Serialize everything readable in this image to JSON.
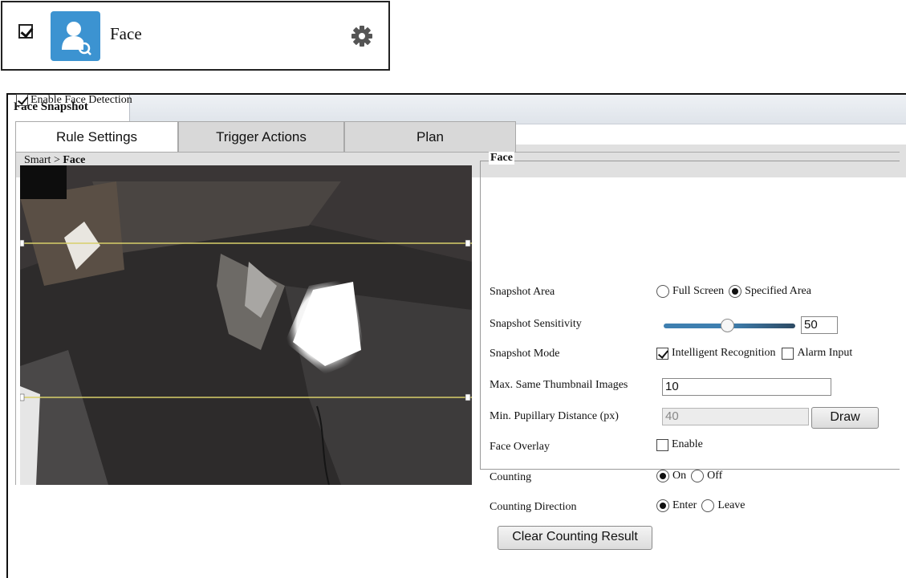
{
  "module": {
    "name": "Face",
    "checked": true
  },
  "panel": {
    "tab_title": "Face Snapshot",
    "breadcrumb": {
      "parent": "Smart",
      "separator": ">",
      "current": "Face"
    },
    "enable_label": "Enable Face Detection",
    "tabs": [
      {
        "label": "Rule Settings",
        "active": true
      },
      {
        "label": "Trigger Actions",
        "active": false
      },
      {
        "label": "Plan",
        "active": false
      }
    ]
  },
  "face": {
    "legend": "Face",
    "snapshot_area": {
      "label": "Snapshot Area",
      "options": [
        "Full Screen",
        "Specified Area"
      ],
      "selected": "Specified Area"
    },
    "sensitivity": {
      "label": "Snapshot Sensitivity",
      "value": "50",
      "level": 0.5
    },
    "snapshot_mode": {
      "label": "Snapshot Mode",
      "options": [
        {
          "label": "Intelligent Recognition",
          "checked": true
        },
        {
          "label": "Alarm Input",
          "checked": false
        }
      ]
    },
    "max_thumbnails": {
      "label": "Max. Same Thumbnail Images",
      "value": "10"
    },
    "min_pupillary": {
      "label": "Min. Pupillary Distance (px)",
      "value": "40",
      "button": "Draw"
    },
    "face_overlay": {
      "label": "Face Overlay",
      "option": "Enable",
      "checked": false
    },
    "counting": {
      "label": "Counting",
      "options": [
        "On",
        "Off"
      ],
      "selected": "On"
    },
    "counting_direction": {
      "label": "Counting Direction",
      "options": [
        "Enter",
        "Leave"
      ],
      "selected": "Enter"
    },
    "clear_button": "Clear Counting Result"
  },
  "colors": {
    "tile": "#3c93d1",
    "slider": "#3e7fb0",
    "detection_line": "#d8cf6a"
  },
  "icons": [
    "checkbox-icon",
    "face-search-icon",
    "gear-icon"
  ]
}
